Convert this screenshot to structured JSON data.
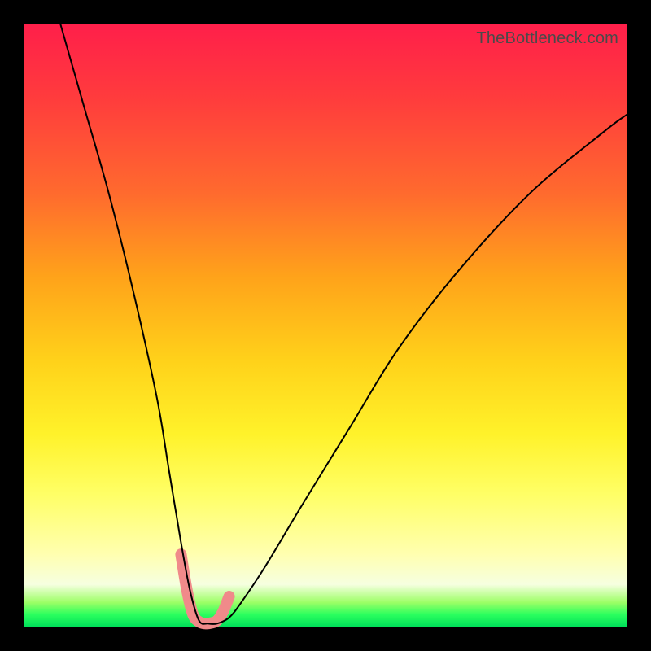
{
  "watermark": "TheBottleneck.com",
  "chart_data": {
    "type": "line",
    "title": "",
    "xlabel": "",
    "ylabel": "",
    "xlim": [
      0,
      100
    ],
    "ylim": [
      0,
      100
    ],
    "grid": false,
    "legend": false,
    "background_gradient": {
      "direction": "vertical",
      "stops": [
        {
          "pos": 0.0,
          "color": "#ff1f4a"
        },
        {
          "pos": 0.28,
          "color": "#ff6a2e"
        },
        {
          "pos": 0.56,
          "color": "#ffd21a"
        },
        {
          "pos": 0.78,
          "color": "#ffff66"
        },
        {
          "pos": 0.93,
          "color": "#f6ffe0"
        },
        {
          "pos": 1.0,
          "color": "#00e05a"
        }
      ]
    },
    "series": [
      {
        "name": "bottleneck-curve",
        "color": "#000000",
        "x": [
          6,
          10,
          14,
          18,
          22,
          24,
          26,
          27.5,
          29,
          30.5,
          32,
          34,
          36,
          40,
          46,
          54,
          62,
          72,
          84,
          96,
          100
        ],
        "y": [
          100,
          86,
          72,
          56,
          38,
          26,
          14,
          6,
          1,
          0.5,
          0.5,
          1.5,
          4,
          10,
          20,
          33,
          46,
          59,
          72,
          82,
          85
        ]
      },
      {
        "name": "optimal-range-highlight",
        "color": "#f08a8a",
        "x": [
          26,
          27,
          28,
          29,
          30,
          31,
          32,
          33,
          34
        ],
        "y": [
          12,
          6,
          2,
          0.8,
          0.5,
          0.6,
          1.0,
          2.5,
          5
        ]
      }
    ],
    "annotations": []
  }
}
